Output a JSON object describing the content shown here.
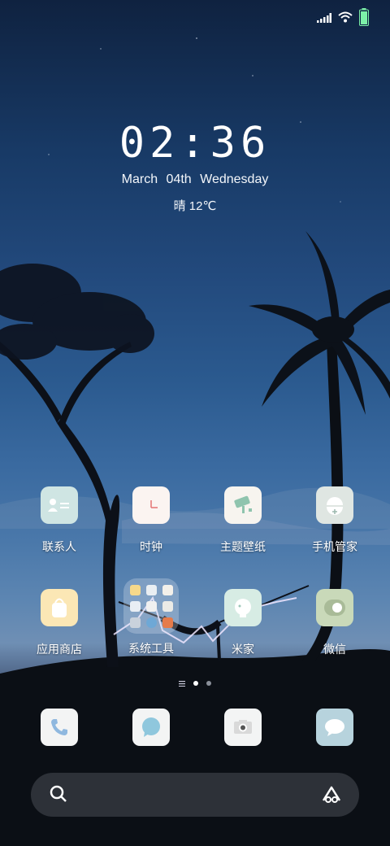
{
  "clock": {
    "time": "02:36",
    "date": "March  04th  Wednesday",
    "weather": "晴 12℃"
  },
  "apps": [
    {
      "label": "联系人",
      "icon": "contacts-icon",
      "bg": "#cfe5e3"
    },
    {
      "label": "时钟",
      "icon": "clock-icon",
      "bg": "#fbf4f1"
    },
    {
      "label": "主题壁纸",
      "icon": "themes-icon",
      "bg": "#f7f4ef"
    },
    {
      "label": "手机管家",
      "icon": "security-icon",
      "bg": "#dfe6e2"
    },
    {
      "label": "应用商店",
      "icon": "app-store-icon",
      "bg": "#fbe7b5"
    },
    {
      "label": "系统工具",
      "icon": "folder-icon",
      "bg": "#e1e8f4"
    },
    {
      "label": "米家",
      "icon": "mi-home-icon",
      "bg": "#d7ece4"
    },
    {
      "label": "微信",
      "icon": "wechat-icon",
      "bg": "#c9d9b9"
    }
  ],
  "dock": [
    {
      "name": "phone-icon"
    },
    {
      "name": "messages-icon"
    },
    {
      "name": "camera-icon"
    },
    {
      "name": "browser-icon"
    }
  ],
  "page_indicator": {
    "pages": 2,
    "current": 1
  },
  "colors": {
    "accent_teal": "#8fc7c2",
    "accent_blue": "#6ea8d6"
  }
}
